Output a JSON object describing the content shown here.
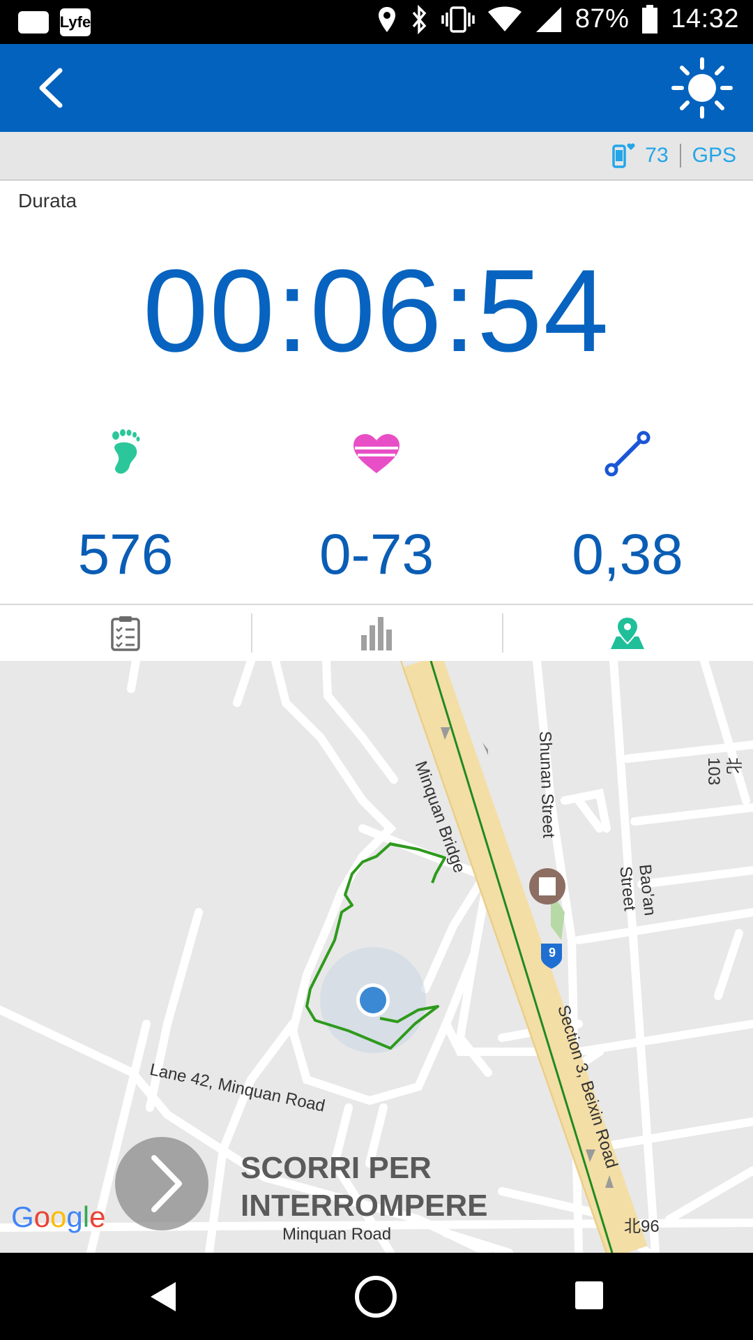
{
  "status_bar": {
    "lyfe_label": "Lyfe",
    "battery": "87%",
    "time": "14:32"
  },
  "app_bar": {
    "back_icon": "chevron-left-icon",
    "action_icon": "sun-icon"
  },
  "info_bar": {
    "heart_rate": "73",
    "gps_label": "GPS"
  },
  "workout": {
    "duration_label": "Durata",
    "duration": "00:06:54"
  },
  "stats": [
    {
      "icon": "footprint-icon",
      "value": "576",
      "color": "#2BC79A"
    },
    {
      "icon": "heart-icon",
      "value": "0-73",
      "color": "#E84FC6"
    },
    {
      "icon": "distance-icon",
      "value": "0,38",
      "color": "#1A56D6"
    }
  ],
  "tabs": [
    {
      "icon": "clipboard-icon",
      "active": false
    },
    {
      "icon": "bar-chart-icon",
      "active": false
    },
    {
      "icon": "map-pin-icon",
      "active": true
    }
  ],
  "map": {
    "labels": {
      "minquan_bridge": "Minquan Bridge",
      "shunan_street": "Shunan Street",
      "baoan_street": "Bao'an Street",
      "lane42": "Lane 42, Minquan Road",
      "section3": "Section 3, Beixin Road",
      "minquan_road": "Minquan Road",
      "bei103": "北103",
      "bei96": "北96",
      "route9": "9"
    },
    "google_logo": "Google",
    "slide_text_line1": "SCORRI PER",
    "slide_text_line2": "INTERROMPERE",
    "accent_color": "#0262BE",
    "route_color": "#2E9A1C"
  }
}
